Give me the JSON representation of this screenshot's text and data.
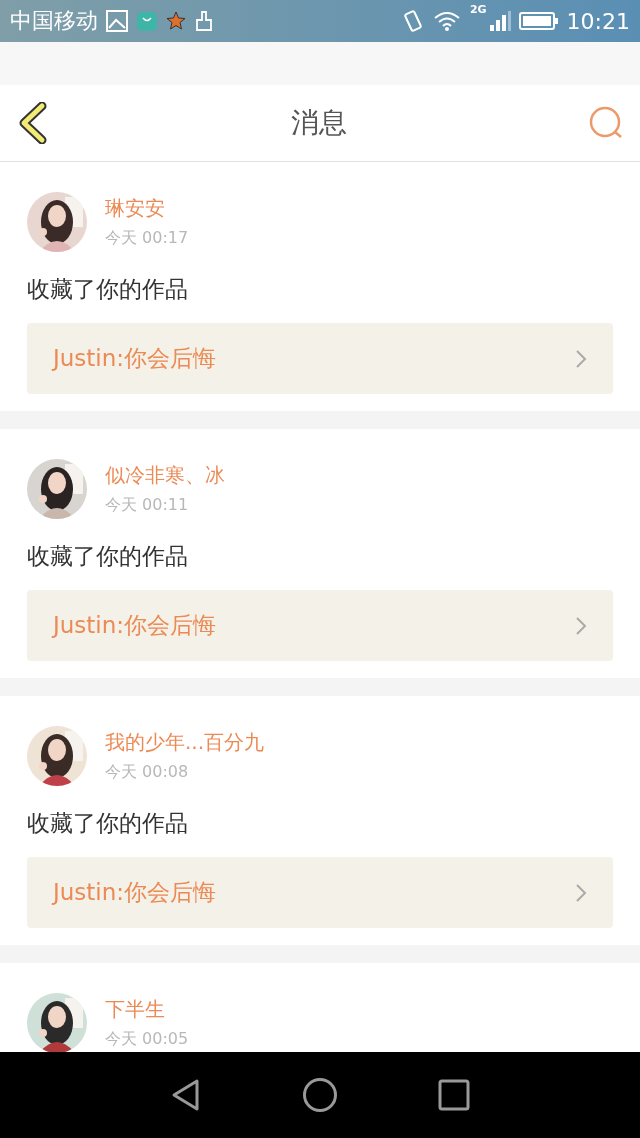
{
  "status_bar": {
    "carrier": "中国移动",
    "network": "2G",
    "time": "10:21"
  },
  "header": {
    "title": "消息"
  },
  "messages": [
    {
      "user": "琳安安",
      "time": "今天 00:17",
      "action": "收藏了你的作品",
      "work": "Justin:你会后悔"
    },
    {
      "user": "似冷非寒、冰",
      "time": "今天 00:11",
      "action": "收藏了你的作品",
      "work": "Justin:你会后悔"
    },
    {
      "user": "我的少年...百分九",
      "time": "今天 00:08",
      "action": "收藏了你的作品",
      "work": "Justin:你会后悔"
    },
    {
      "user": "下半生",
      "time": "今天 00:05"
    }
  ]
}
